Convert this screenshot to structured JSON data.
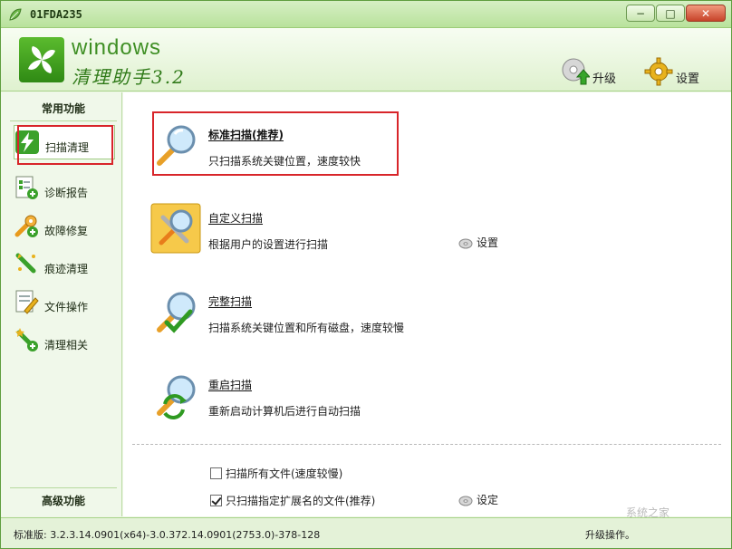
{
  "window": {
    "title": "01FDA235",
    "minimize_glyph": "−",
    "maximize_glyph": "□",
    "close_glyph": "✕"
  },
  "header": {
    "logo_en": "windows",
    "logo_cn": "清理助手3.2",
    "upgrade_label": "升级",
    "settings_label": "设置"
  },
  "sidebar": {
    "section_common": "常用功能",
    "section_advanced": "高级功能",
    "items": [
      {
        "label": "扫描清理",
        "icon": "lightning-icon"
      },
      {
        "label": "诊断报告",
        "icon": "report-icon"
      },
      {
        "label": "故障修复",
        "icon": "wrench-icon"
      },
      {
        "label": "痕迹清理",
        "icon": "broom-icon"
      },
      {
        "label": "文件操作",
        "icon": "file-edit-icon"
      },
      {
        "label": "清理相关",
        "icon": "star-wand-icon"
      }
    ]
  },
  "scans": [
    {
      "title": "标准扫描(推荐)",
      "desc": "只扫描系统关键位置，速度较快"
    },
    {
      "title": "自定义扫描",
      "desc": "根据用户的设置进行扫描",
      "settings_label": "设置"
    },
    {
      "title": "完整扫描",
      "desc": "扫描系统关键位置和所有磁盘，速度较慢"
    },
    {
      "title": "重启扫描",
      "desc": "重新启动计算机后进行自动扫描"
    }
  ],
  "options": {
    "scan_all_label": "扫描所有文件(速度较慢)",
    "scan_all_checked": false,
    "scan_ext_label": "只扫描指定扩展名的文件(推荐)",
    "scan_ext_checked": true,
    "set_label": "设定"
  },
  "status": {
    "version": "标准版: 3.2.3.14.0901(x64)-3.0.372.14.0901(2753.0)-378-128",
    "right_text": "升级操作。"
  },
  "watermark": "系统之家",
  "colors": {
    "accent_green": "#3f8f24",
    "highlight_red": "#d8252a",
    "bg_light_green": "#eef7e6"
  }
}
